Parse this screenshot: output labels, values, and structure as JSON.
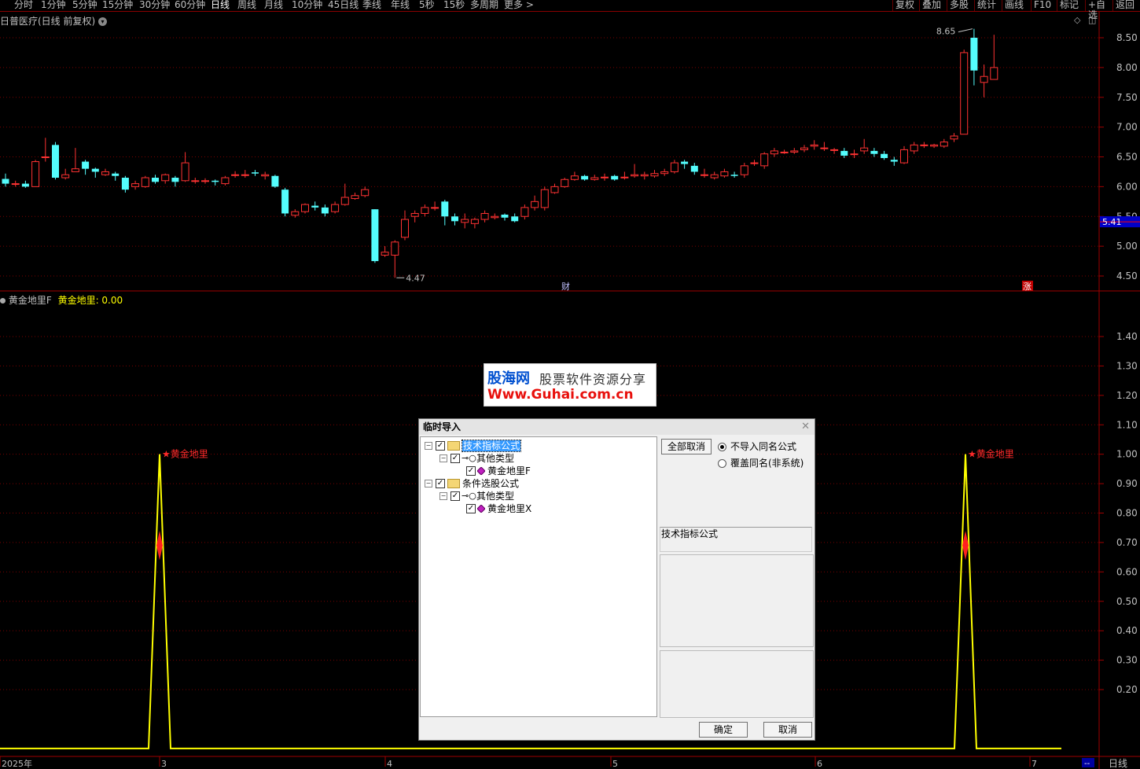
{
  "toolbar": {
    "periods": [
      "分时",
      "1分钟",
      "5分钟",
      "15分钟",
      "30分钟",
      "60分钟",
      "日线",
      "周线",
      "月线",
      "10分钟",
      "45日线",
      "季线",
      "年线",
      "5秒",
      "15秒",
      "多周期",
      "更多 >"
    ],
    "active_period": "日线",
    "right": [
      "复权",
      "叠加",
      "多股",
      "统计",
      "画线",
      "F10",
      "标记",
      "+自选",
      "返回"
    ]
  },
  "stock": {
    "title": "日普医疗(日线 前复权)",
    "last_price_label": "5.41",
    "high_label": "8.65",
    "low_label": "4.47",
    "marker_cai": "财",
    "marker_zhang": "涨"
  },
  "price_axis": [
    "8.50",
    "8.00",
    "7.50",
    "7.00",
    "6.50",
    "6.00",
    "5.50",
    "5.00",
    "4.50"
  ],
  "indicator": {
    "name": "黄金地里F",
    "value_label": "黄金地里: 0.00",
    "signal_label": "黄金地里",
    "axis": [
      "1.40",
      "1.30",
      "1.20",
      "1.10",
      "1.00",
      "0.90",
      "0.80",
      "0.70",
      "0.60",
      "0.50",
      "0.40",
      "0.30",
      "0.20"
    ]
  },
  "date_axis": {
    "labels": [
      "2025年",
      "3",
      "4",
      "5",
      "6",
      "7"
    ],
    "right_button": "--",
    "period_label": "日线"
  },
  "watermark": {
    "name": "股海网",
    "slogan": "股票软件资源分享",
    "url": "Www.Guhai.com.cn"
  },
  "dialog": {
    "title": "临时导入",
    "tree": [
      {
        "label": "技术指标公式",
        "level": 0,
        "selected": true
      },
      {
        "label": "其他类型",
        "level": 1
      },
      {
        "label": "黄金地里F",
        "level": 2
      },
      {
        "label": "条件选股公式",
        "level": 0
      },
      {
        "label": "其他类型",
        "level": 1
      },
      {
        "label": "黄金地里X",
        "level": 2
      }
    ],
    "select_all_button": "全部取消",
    "radio_no_import": "不导入同名公式",
    "radio_overwrite": "覆盖同名(非系统)",
    "info_label": "技术指标公式",
    "ok": "确定",
    "cancel": "取消"
  },
  "chart_data": {
    "type": "candlestick",
    "price_range": [
      4.3,
      8.75
    ],
    "candles": [
      [
        6.13,
        6.05,
        6.22,
        6.0
      ],
      [
        6.05,
        6.05,
        6.1,
        6.0
      ],
      [
        6.05,
        6.0,
        6.1,
        5.98
      ],
      [
        6.0,
        6.42,
        6.45,
        6.0
      ],
      [
        6.5,
        6.5,
        6.82,
        6.42
      ],
      [
        6.7,
        6.15,
        6.75,
        6.12
      ],
      [
        6.15,
        6.2,
        6.3,
        6.12
      ],
      [
        6.25,
        6.3,
        6.65,
        6.25
      ],
      [
        6.42,
        6.3,
        6.45,
        6.2
      ],
      [
        6.3,
        6.25,
        6.32,
        6.15
      ],
      [
        6.2,
        6.25,
        6.3,
        6.18
      ],
      [
        6.22,
        6.18,
        6.25,
        6.1
      ],
      [
        6.15,
        5.95,
        6.18,
        5.9
      ],
      [
        6.0,
        6.05,
        6.1,
        5.95
      ],
      [
        6.0,
        6.15,
        6.18,
        5.98
      ],
      [
        6.15,
        6.08,
        6.2,
        6.05
      ],
      [
        6.1,
        6.2,
        6.22,
        6.05
      ],
      [
        6.15,
        6.08,
        6.18,
        6.0
      ],
      [
        6.1,
        6.4,
        6.58,
        6.08
      ],
      [
        6.1,
        6.1,
        6.15,
        6.05
      ],
      [
        6.1,
        6.1,
        6.14,
        6.05
      ],
      [
        6.1,
        6.08,
        6.12,
        6.02
      ],
      [
        6.05,
        6.15,
        6.18,
        6.02
      ],
      [
        6.2,
        6.2,
        6.26,
        6.15
      ],
      [
        6.2,
        6.2,
        6.28,
        6.15
      ],
      [
        6.24,
        6.22,
        6.28,
        6.18
      ],
      [
        6.18,
        6.2,
        6.25,
        6.12
      ],
      [
        6.18,
        6.0,
        6.2,
        5.98
      ],
      [
        5.95,
        5.55,
        5.98,
        5.5
      ],
      [
        5.52,
        5.58,
        5.62,
        5.48
      ],
      [
        5.58,
        5.7,
        5.72,
        5.55
      ],
      [
        5.68,
        5.65,
        5.75,
        5.6
      ],
      [
        5.65,
        5.55,
        5.7,
        5.5
      ],
      [
        5.58,
        5.7,
        5.75,
        5.55
      ],
      [
        5.7,
        5.82,
        6.05,
        5.68
      ],
      [
        5.8,
        5.85,
        5.9,
        5.78
      ],
      [
        5.85,
        5.95,
        6.0,
        5.82
      ],
      [
        5.62,
        4.75,
        5.62,
        4.72
      ],
      [
        4.85,
        4.9,
        5.0,
        4.82
      ],
      [
        4.85,
        5.07,
        5.1,
        4.47
      ],
      [
        5.15,
        5.45,
        5.6,
        5.1
      ],
      [
        5.5,
        5.55,
        5.6,
        5.4
      ],
      [
        5.55,
        5.65,
        5.7,
        5.5
      ],
      [
        5.65,
        5.65,
        5.75,
        5.6
      ],
      [
        5.75,
        5.5,
        5.78,
        5.35
      ],
      [
        5.5,
        5.42,
        5.55,
        5.35
      ],
      [
        5.4,
        5.45,
        5.55,
        5.3
      ],
      [
        5.38,
        5.45,
        5.48,
        5.3
      ],
      [
        5.45,
        5.55,
        5.6,
        5.4
      ],
      [
        5.48,
        5.5,
        5.55,
        5.45
      ],
      [
        5.53,
        5.48,
        5.55,
        5.43
      ],
      [
        5.5,
        5.42,
        5.55,
        5.4
      ],
      [
        5.5,
        5.65,
        5.7,
        5.45
      ],
      [
        5.65,
        5.75,
        5.85,
        5.6
      ],
      [
        5.65,
        5.95,
        6.0,
        5.6
      ],
      [
        5.9,
        6.0,
        6.05,
        5.88
      ],
      [
        6.0,
        6.12,
        6.15,
        5.98
      ],
      [
        6.12,
        6.18,
        6.25,
        6.1
      ],
      [
        6.18,
        6.12,
        6.2,
        6.1
      ],
      [
        6.12,
        6.15,
        6.2,
        6.1
      ],
      [
        6.16,
        6.16,
        6.22,
        6.1
      ],
      [
        6.18,
        6.12,
        6.2,
        6.1
      ],
      [
        6.15,
        6.16,
        6.25,
        6.12
      ],
      [
        6.18,
        6.2,
        6.38,
        6.15
      ],
      [
        6.18,
        6.2,
        6.25,
        6.12
      ],
      [
        6.18,
        6.22,
        6.28,
        6.15
      ],
      [
        6.22,
        6.25,
        6.3,
        6.18
      ],
      [
        6.25,
        6.4,
        6.45,
        6.22
      ],
      [
        6.42,
        6.38,
        6.45,
        6.3
      ],
      [
        6.35,
        6.25,
        6.4,
        6.2
      ],
      [
        6.2,
        6.2,
        6.3,
        6.15
      ],
      [
        6.15,
        6.2,
        6.25,
        6.12
      ],
      [
        6.18,
        6.25,
        6.3,
        6.15
      ],
      [
        6.2,
        6.18,
        6.25,
        6.15
      ],
      [
        6.2,
        6.35,
        6.4,
        6.15
      ],
      [
        6.4,
        6.4,
        6.45,
        6.35
      ],
      [
        6.35,
        6.55,
        6.58,
        6.3
      ],
      [
        6.55,
        6.6,
        6.65,
        6.5
      ],
      [
        6.58,
        6.58,
        6.62,
        6.55
      ],
      [
        6.58,
        6.6,
        6.65,
        6.55
      ],
      [
        6.62,
        6.65,
        6.7,
        6.58
      ],
      [
        6.68,
        6.7,
        6.78,
        6.62
      ],
      [
        6.65,
        6.65,
        6.75,
        6.6
      ],
      [
        6.62,
        6.62,
        6.65,
        6.55
      ],
      [
        6.6,
        6.52,
        6.65,
        6.48
      ],
      [
        6.55,
        6.55,
        6.62,
        6.48
      ],
      [
        6.6,
        6.65,
        6.8,
        6.55
      ],
      [
        6.6,
        6.55,
        6.65,
        6.5
      ],
      [
        6.55,
        6.48,
        6.6,
        6.45
      ],
      [
        6.45,
        6.42,
        6.5,
        6.35
      ],
      [
        6.4,
        6.62,
        6.68,
        6.38
      ],
      [
        6.6,
        6.7,
        6.75,
        6.55
      ],
      [
        6.7,
        6.7,
        6.75,
        6.65
      ],
      [
        6.68,
        6.7,
        6.72,
        6.65
      ],
      [
        6.68,
        6.75,
        6.8,
        6.65
      ],
      [
        6.8,
        6.85,
        6.9,
        6.75
      ],
      [
        6.88,
        8.25,
        8.3,
        6.88
      ],
      [
        8.5,
        7.95,
        8.65,
        7.7
      ],
      [
        7.75,
        7.85,
        8.05,
        7.5
      ],
      [
        7.8,
        8.0,
        8.55,
        7.8
      ]
    ],
    "indicator_series": {
      "name": "黄金地里",
      "baseline": 0,
      "spikes": [
        {
          "index": 4,
          "value": 1.0
        },
        {
          "index": 88,
          "value": 1.0
        }
      ]
    }
  }
}
